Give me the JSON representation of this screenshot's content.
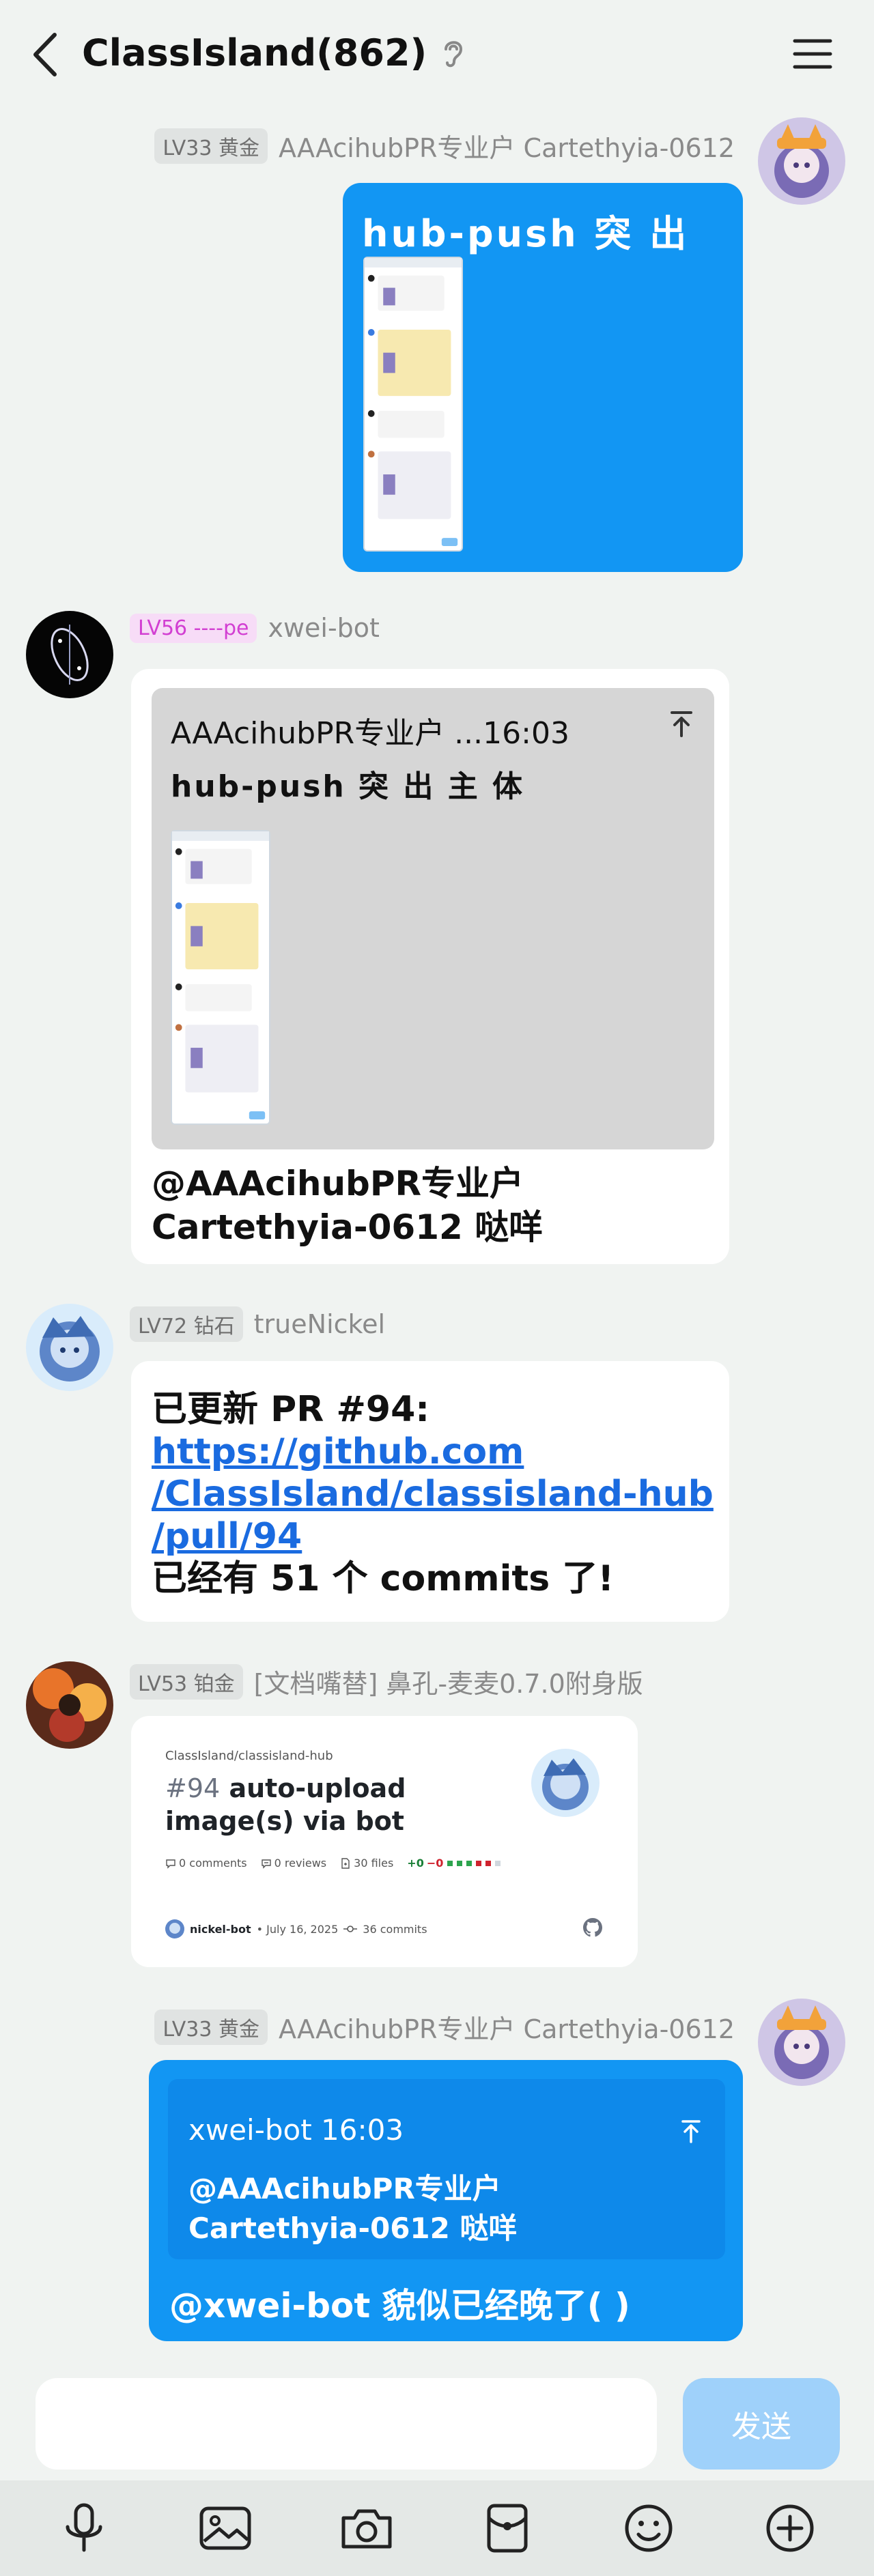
{
  "header": {
    "title": "ClassIsland(862)"
  },
  "messages": [
    {
      "id": "m1",
      "side": "right",
      "badge": "LV33 黄金",
      "sender": "AAAcihubPR专业户 Cartethyia-0612",
      "text": "hub-push 突 出 主 体"
    },
    {
      "id": "m2",
      "side": "left",
      "badge": "LV56 ----pe",
      "sender": "xwei-bot",
      "quote_head": "AAAcihubPR专业户 ...16:03",
      "quote_text": "hub-push 突 出 主 体",
      "text_line1": "@AAAcihubPR专业户",
      "text_line2": "Cartethyia-0612 哒咩"
    },
    {
      "id": "m3",
      "side": "left",
      "badge": "LV72 钻石",
      "sender": "trueNickel",
      "text_line1": "已更新 PR #94:",
      "link_line1": "https://github.com",
      "link_line2": "/ClassIsland/classisland-hub",
      "link_line3": "/pull/94",
      "text_line2": "已经有 51 个 commits 了!"
    },
    {
      "id": "m4",
      "side": "left",
      "badge": "LV53 铂金",
      "sender": "[文档嘴替] 鼻孔-麦麦0.7.0附身版",
      "card": {
        "repo": "ClassIsland/classisland-hub",
        "number": "#94",
        "title": "auto-upload image(s) via bot",
        "comments": "0 comments",
        "reviews": "0 reviews",
        "files": "30 files",
        "additions": "+0",
        "deletions": "−0",
        "author": "nickel-bot",
        "date": "• July 16, 2025",
        "commits": "36 commits"
      }
    },
    {
      "id": "m5",
      "side": "right",
      "badge": "LV33 黄金",
      "sender": "AAAcihubPR专业户 Cartethyia-0612",
      "reply_head": "xwei-bot 16:03",
      "reply_line1": "@AAAcihubPR专业户",
      "reply_line2": "Cartethyia-0612 哒咩",
      "text": "@xwei-bot 貌似已经晚了( )"
    }
  ],
  "composer": {
    "placeholder": "",
    "send_label": "发送"
  },
  "toolbar": {
    "icons": [
      "microphone-icon",
      "image-icon",
      "camera-icon",
      "red-packet-icon",
      "emoji-icon",
      "plus-icon"
    ]
  },
  "colors": {
    "background": "#f0f3f1",
    "self_bubble": "#1296f3",
    "link": "#1a6be0",
    "send_button": "#9fd1fa"
  }
}
